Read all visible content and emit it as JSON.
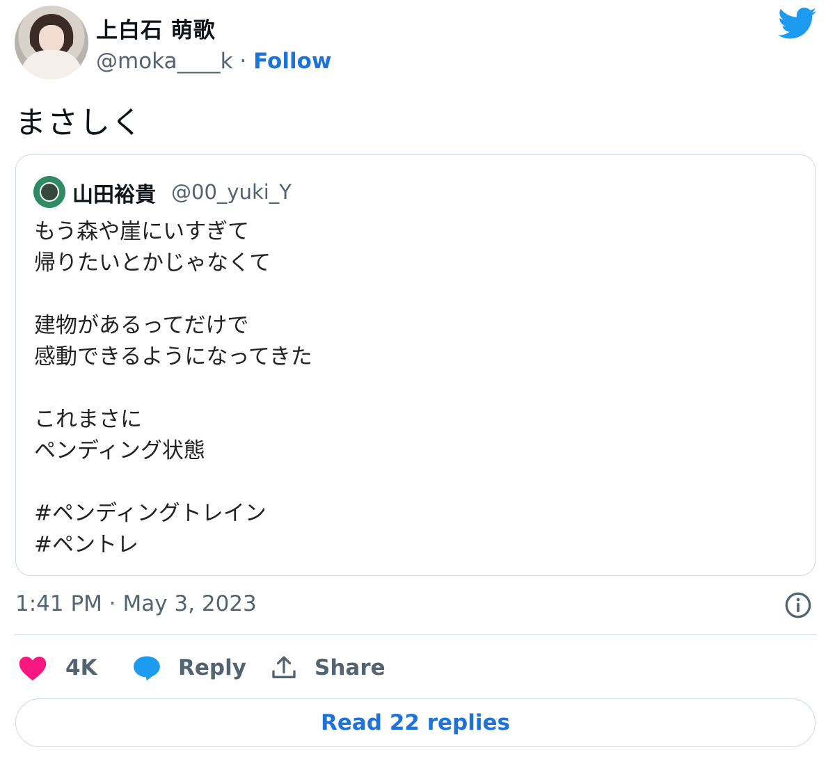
{
  "author": {
    "name": "上白石 萌歌",
    "handle": "@moka____k",
    "separator": "·",
    "follow_label": "Follow"
  },
  "tweet": {
    "text": "まさしく",
    "timestamp": "1:41 PM · May 3, 2023"
  },
  "quoted_tweet": {
    "name": "山田裕貴",
    "handle": "@00_yuki_Y",
    "body": "もう森や崖にいすぎて\n帰りたいとかじゃなくて\n\n建物があるってだけで\n感動できるようになってきた\n\nこれまさに\nペンディング状態\n\n#ペンディングトレイン\n#ペントレ"
  },
  "actions": {
    "likes": "4K",
    "reply_label": "Reply",
    "share_label": "Share"
  },
  "read_replies_label": "Read 22 replies",
  "colors": {
    "twitter_blue": "#1d9bf0",
    "link_blue": "#1d73d8",
    "heart": "#f91880",
    "muted": "#536471",
    "border": "#cfd9de"
  },
  "icons": [
    "twitter-bird-icon",
    "info-icon",
    "heart-icon",
    "reply-bubble-icon",
    "share-icon"
  ]
}
